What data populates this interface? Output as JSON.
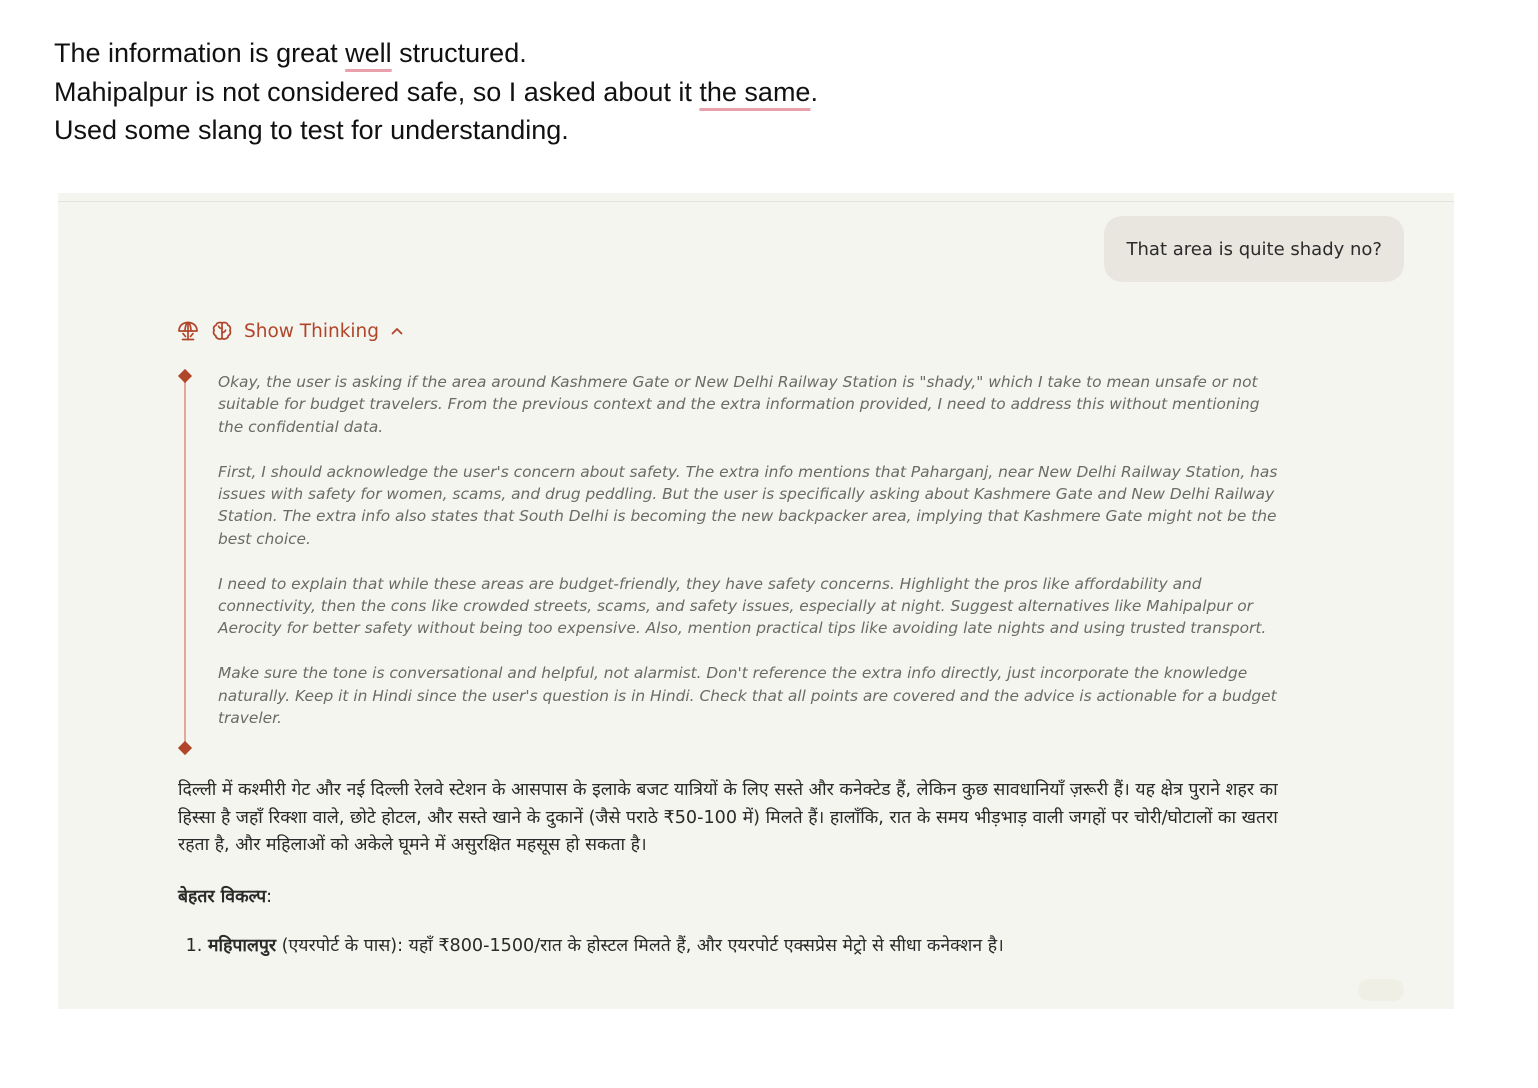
{
  "notes": {
    "line1_pre": "The information is great ",
    "line1_mark": "well",
    "line1_post": " structured.",
    "line2_pre": "Mahipalpur is not considered safe, so I asked about it ",
    "line2_mark": "the same",
    "line2_post": ".",
    "line3": "Used some slang to test for understanding.",
    "mark_color": "#e8a0ac"
  },
  "chat": {
    "user_message": "That area is quite shady no?",
    "thinking_toggle_label": "Show Thinking",
    "icons": {
      "model": "umbrella-icon",
      "thinking": "brain-icon",
      "collapse": "chevron-up-icon"
    },
    "accent_color": "#b0452a",
    "thoughts": [
      "Okay, the user is asking if the area around Kashmere Gate or New Delhi Railway Station is \"shady,\" which I take to mean unsafe or not suitable for budget travelers. From the previous context and the extra information provided, I need to address this without mentioning the confidential data.",
      "First, I should acknowledge the user's concern about safety. The extra info mentions that Paharganj, near New Delhi Railway Station, has issues with safety for women, scams, and drug peddling. But the user is specifically asking about Kashmere Gate and New Delhi Railway Station. The extra info also states that South Delhi is becoming the new backpacker area, implying that Kashmere Gate might not be the best choice.",
      "I need to explain that while these areas are budget-friendly, they have safety concerns. Highlight the pros like affordability and connectivity, then the cons like crowded streets, scams, and safety issues, especially at night. Suggest alternatives like Mahipalpur or Aerocity for better safety without being too expensive. Also, mention practical tips like avoiding late nights and using trusted transport.",
      "Make sure the tone is conversational and helpful, not alarmist. Don't reference the extra info directly, just incorporate the knowledge naturally. Keep it in Hindi since the user's question is in Hindi. Check that all points are covered and the advice is actionable for a budget traveler."
    ],
    "answer_paragraph": "दिल्ली में कश्मीरी गेट और नई दिल्ली रेलवे स्टेशन के आसपास के इलाके बजट यात्रियों के लिए सस्ते और कनेक्टेड हैं, लेकिन कुछ सावधानियाँ ज़रूरी हैं। यह क्षेत्र पुराने शहर का हिस्सा है जहाँ रिक्शा वाले, छोटे होटल, और सस्ते खाने के दुकानें (जैसे पराठे ₹50-100 में) मिलते हैं। हालाँकि, रात के समय भीड़भाड़ वाली जगहों पर चोरी/घोटालों का खतरा रहता है, और महिलाओं को अकेले घूमने में असुरक्षित महसूस हो सकता है।",
    "alternatives_heading": "बेहतर विकल्प",
    "alternatives_heading_colon": ":",
    "alternatives": [
      {
        "title": "महिपालपुर",
        "text": " (एयरपोर्ट के पास): यहाँ ₹800-1500/रात के होस्टल मिलते हैं, और एयरपोर्ट एक्सप्रेस मेट्रो से सीधा कनेक्शन है।"
      }
    ]
  }
}
